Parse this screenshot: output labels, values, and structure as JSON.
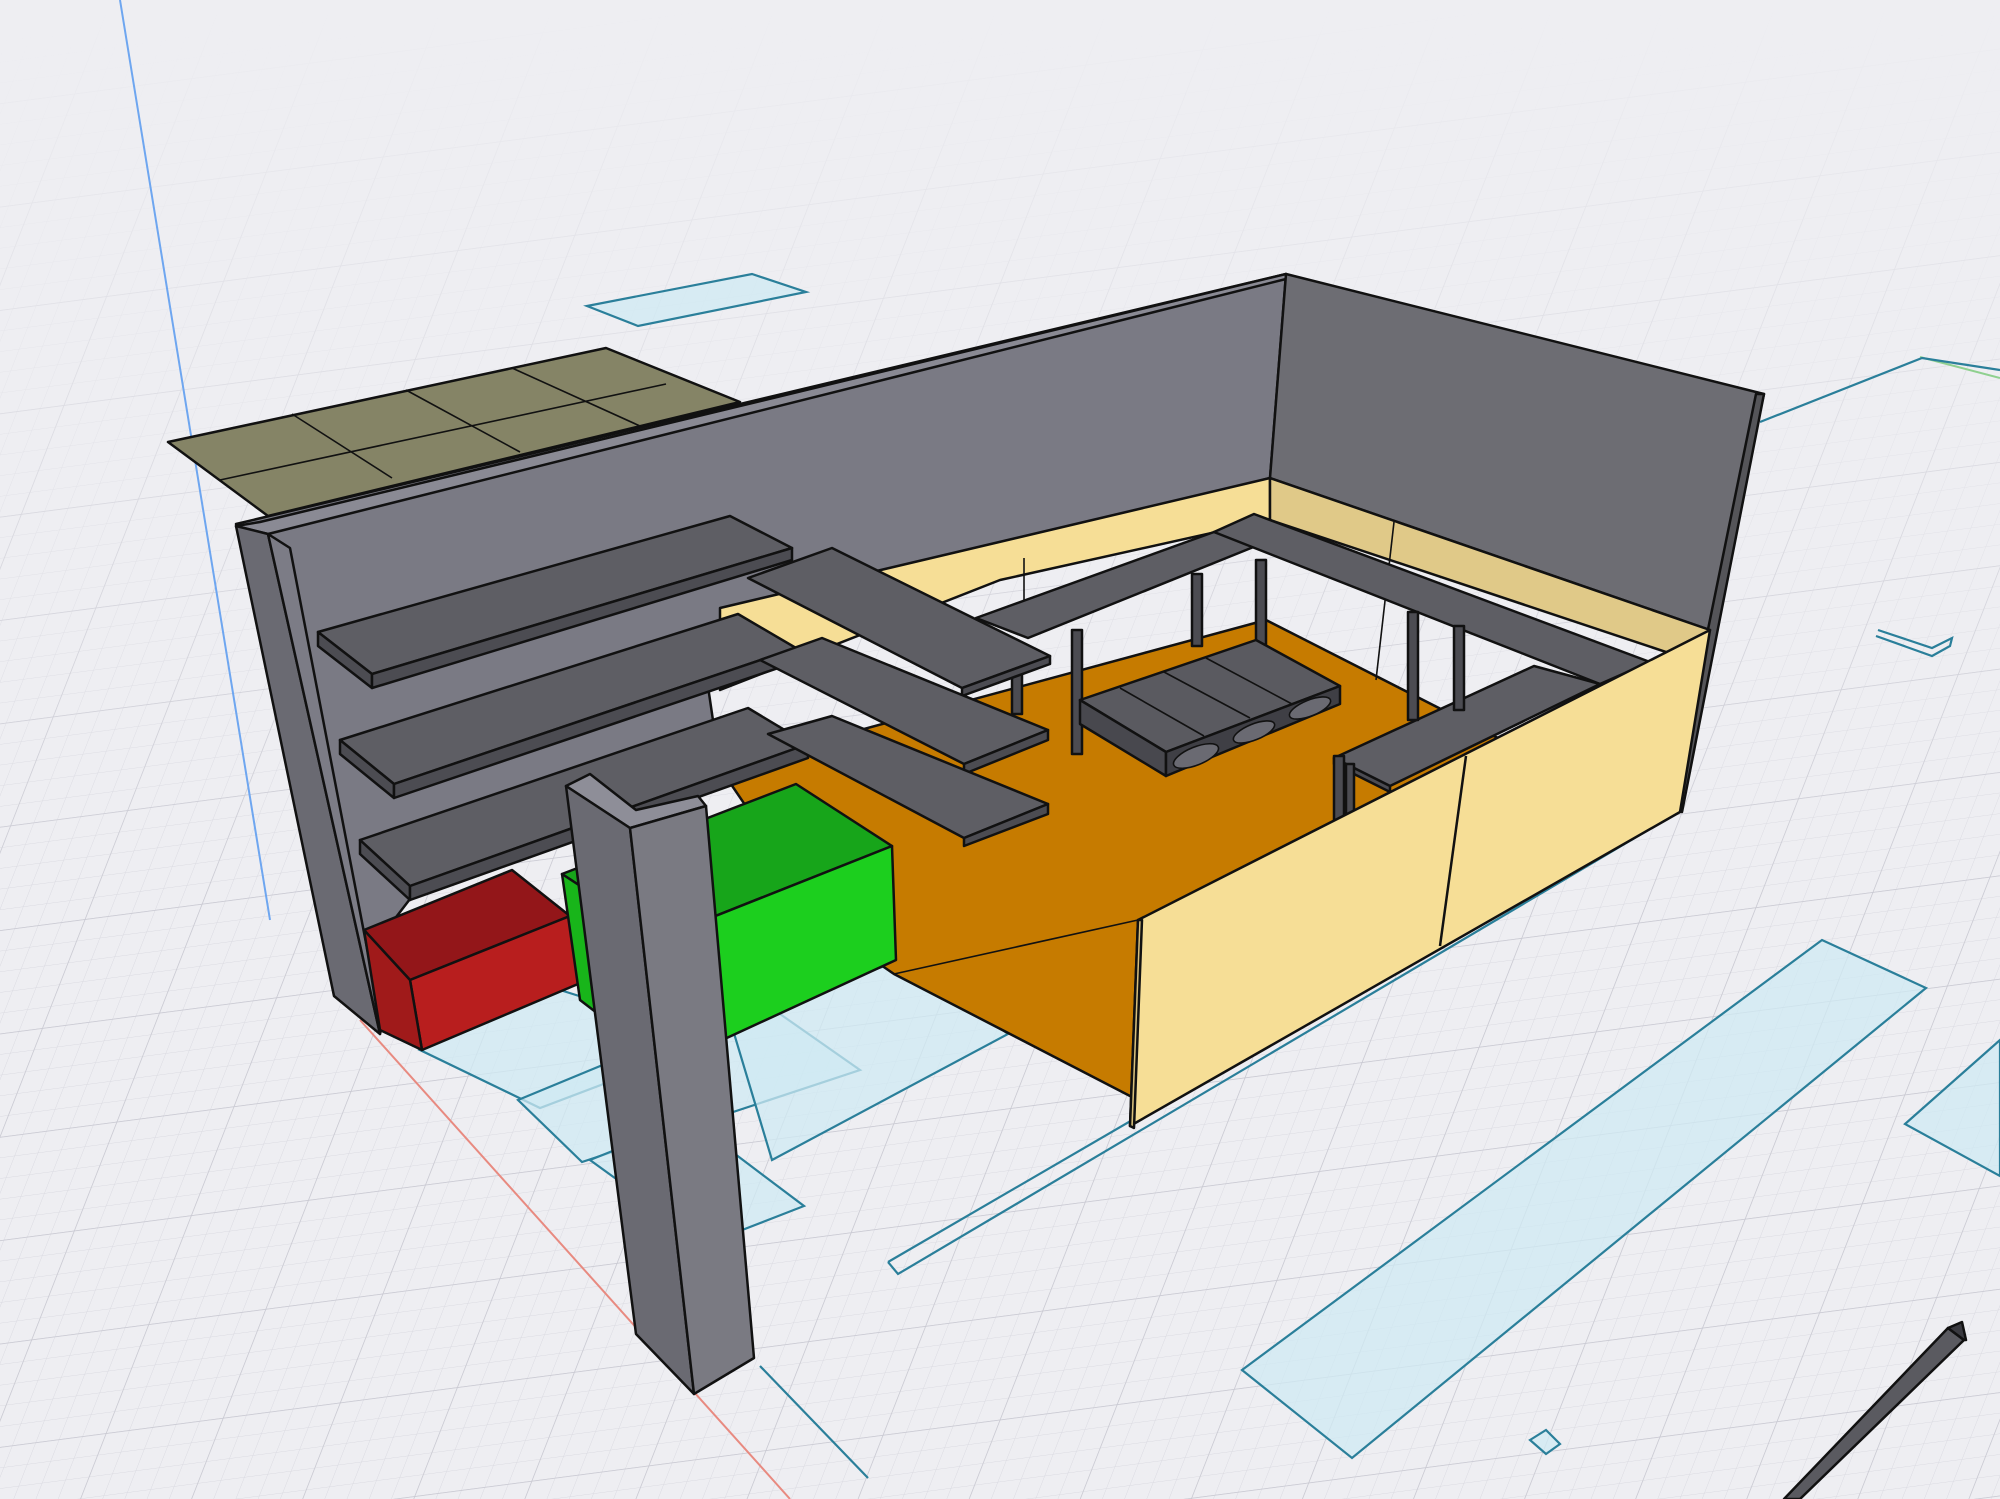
{
  "viewport": {
    "mode": "3d-perspective",
    "background_color": "#eeeef2",
    "grid_color": "#d6d6de",
    "axes": {
      "x_axis_color": "#e88a80",
      "y_axis_color": "#8fd08f",
      "z_axis_color": "#6ea6f0"
    }
  },
  "scene": {
    "objects": [
      {
        "name": "solar-panel-array",
        "color": "#858466"
      },
      {
        "name": "back-wall",
        "color": "#7a7a84"
      },
      {
        "name": "right-back-wall",
        "color": "#6d6d73"
      },
      {
        "name": "wall-shelves-left",
        "count": 3,
        "color": "#5e5e64"
      },
      {
        "name": "wall-shelves-right",
        "count": 3,
        "color": "#5e5e64"
      },
      {
        "name": "workbench-counter",
        "color": "#5e5e64"
      },
      {
        "name": "floor-slab",
        "color": "#c67b00"
      },
      {
        "name": "front-right-wall",
        "color": "#f6de96"
      },
      {
        "name": "red-storage-box",
        "color": "#b81e1e"
      },
      {
        "name": "green-storage-box",
        "color": "#1ccf1e"
      },
      {
        "name": "support-column",
        "color": "#7a7a82"
      },
      {
        "name": "pallet-rack",
        "color": "#5a5a60"
      }
    ],
    "footprint_color": "#cfe9f3",
    "footprint_outline_color": "#2a7f9a"
  }
}
